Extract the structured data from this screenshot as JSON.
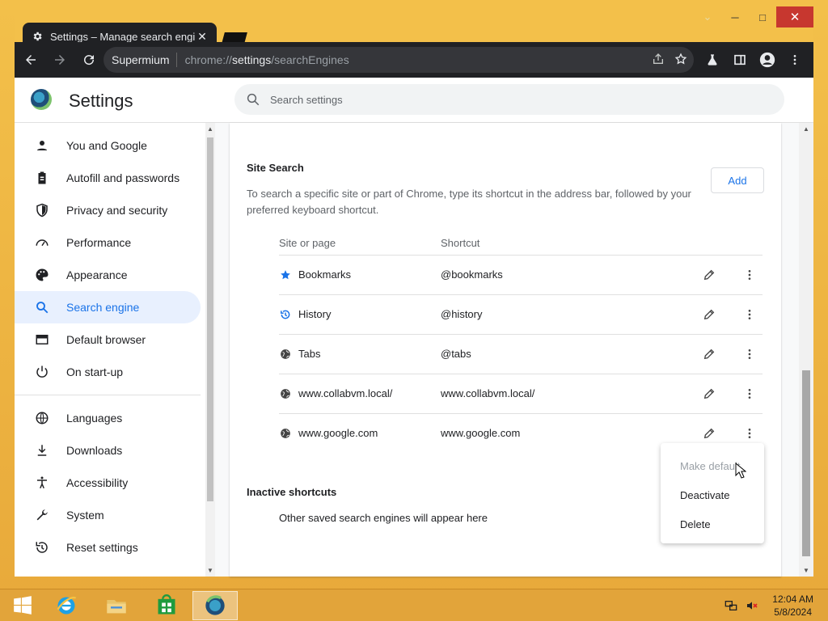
{
  "window": {
    "tab_title": "Settings – Manage search engin",
    "tab_close": "✕",
    "caption": {
      "minimize": "─",
      "maximize": "□",
      "close": "✕",
      "chevron": "⌄"
    }
  },
  "toolbar": {
    "site_label": "Supermium",
    "url_prefix": "chrome://",
    "url_host": "settings",
    "url_path": "/searchEngines"
  },
  "header": {
    "title": "Settings",
    "search_placeholder": "Search settings"
  },
  "sidebar": {
    "items": [
      {
        "label": "You and Google",
        "icon": "person-icon"
      },
      {
        "label": "Autofill and passwords",
        "icon": "clipboard-icon"
      },
      {
        "label": "Privacy and security",
        "icon": "shield-icon"
      },
      {
        "label": "Performance",
        "icon": "speedometer-icon"
      },
      {
        "label": "Appearance",
        "icon": "palette-icon"
      },
      {
        "label": "Search engine",
        "icon": "search-icon"
      },
      {
        "label": "Default browser",
        "icon": "browser-icon"
      },
      {
        "label": "On start-up",
        "icon": "power-icon"
      },
      {
        "label": "Languages",
        "icon": "globe-icon"
      },
      {
        "label": "Downloads",
        "icon": "download-icon"
      },
      {
        "label": "Accessibility",
        "icon": "accessibility-icon"
      },
      {
        "label": "System",
        "icon": "wrench-icon"
      },
      {
        "label": "Reset settings",
        "icon": "reset-icon"
      }
    ],
    "active_index": 5
  },
  "site_search": {
    "title": "Site Search",
    "description": "To search a specific site or part of Chrome, type its shortcut in the address bar, followed by your preferred keyboard shortcut.",
    "add_label": "Add",
    "columns": {
      "site": "Site or page",
      "shortcut": "Shortcut"
    },
    "rows": [
      {
        "site": "Bookmarks",
        "shortcut": "@bookmarks",
        "icon": "star-icon"
      },
      {
        "site": "History",
        "shortcut": "@history",
        "icon": "history-icon"
      },
      {
        "site": "Tabs",
        "shortcut": "@tabs",
        "icon": "globe-icon"
      },
      {
        "site": "www.collabvm.local/",
        "shortcut": "www.collabvm.local/",
        "icon": "globe-icon"
      },
      {
        "site": "www.google.com",
        "shortcut": "www.google.com",
        "icon": "globe-icon"
      }
    ]
  },
  "inactive": {
    "title": "Inactive shortcuts",
    "description": "Other saved search engines will appear here"
  },
  "context_menu": {
    "items": [
      {
        "label": "Make default",
        "disabled": true
      },
      {
        "label": "Deactivate",
        "disabled": false
      },
      {
        "label": "Delete",
        "disabled": false
      }
    ]
  },
  "taskbar": {
    "time": "12:04 AM",
    "date": "5/8/2024"
  },
  "colors": {
    "accent": "#1a73e8",
    "toolbar_bg": "#202124",
    "desktop": "#f0b429"
  }
}
